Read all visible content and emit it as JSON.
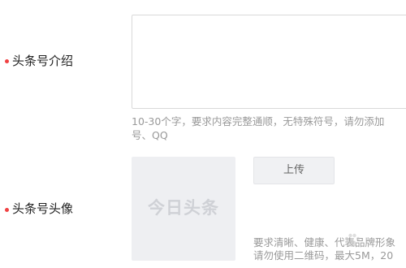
{
  "intro_field": {
    "label": "头条号介绍",
    "value": "",
    "hint_line1": "10-30个字，要求内容完整通顺，无特殊符号，请勿添加",
    "hint_line2": "号、QQ"
  },
  "avatar_field": {
    "label": "头条号头像",
    "placeholder_logo": "今日头条",
    "upload_label": "上传",
    "hint_line1": "要求清晰、健康、代表品牌形象",
    "hint_line2": "请勿使用二维码，最大5M，20"
  },
  "colors": {
    "required_dot": "#f04142",
    "hint_text": "#999999",
    "avatar_bg": "#eeeff2"
  }
}
